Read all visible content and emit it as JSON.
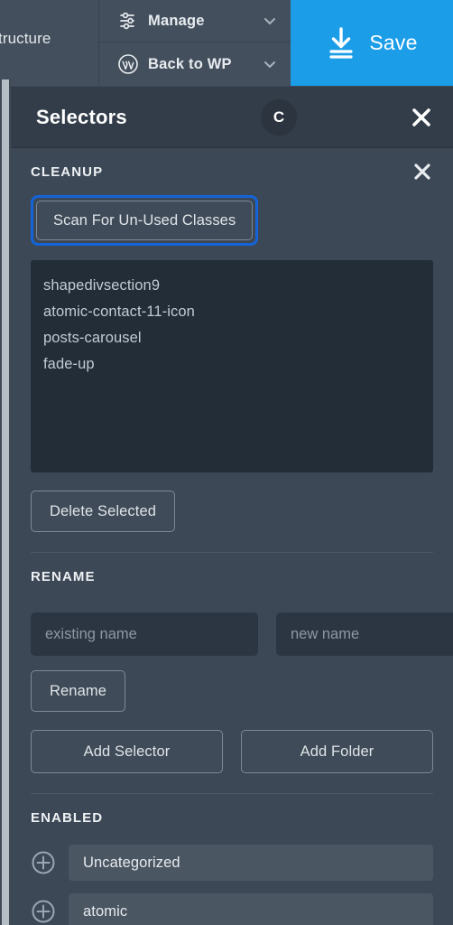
{
  "topbar": {
    "left_label": "tructure",
    "menu_items": [
      {
        "label": "Manage",
        "icon": "sliders-icon"
      },
      {
        "label": "Back to WP",
        "icon": "wordpress-icon"
      }
    ],
    "save_label": "Save",
    "save_icon": "save-download-icon",
    "save_color": "#1c9de8"
  },
  "panel": {
    "title": "Selectors",
    "badge": "C",
    "close_icon": "close-icon"
  },
  "cleanup": {
    "title": "CLEANUP",
    "close_icon": "close-icon",
    "scan_button": "Scan For Un-Used Classes",
    "focus_ring_color": "#1464d8",
    "classes": [
      "shapedivsection9",
      "atomic-contact-11-icon",
      "posts-carousel",
      "fade-up"
    ],
    "delete_button": "Delete Selected"
  },
  "rename": {
    "title": "RENAME",
    "existing_placeholder": "existing name",
    "existing_value": "",
    "new_placeholder": "new name",
    "new_value": "",
    "rename_button": "Rename"
  },
  "add": {
    "add_selector_button": "Add Selector",
    "add_folder_button": "Add Folder"
  },
  "enabled": {
    "title": "ENABLED",
    "folders": [
      {
        "label": "Uncategorized",
        "icon": "plus-circle-icon"
      },
      {
        "label": "atomic",
        "icon": "plus-circle-icon"
      }
    ]
  }
}
